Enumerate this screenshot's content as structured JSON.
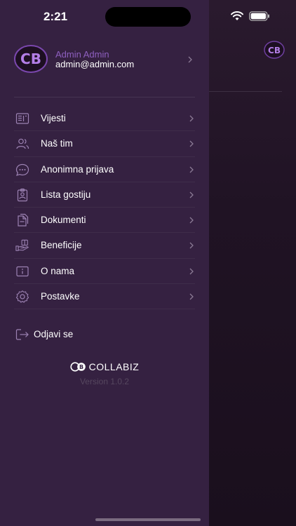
{
  "status_bar": {
    "time": "2:21"
  },
  "profile": {
    "name": "Admin Admin",
    "email": "admin@admin.com",
    "avatar_initials": "CB"
  },
  "menu": [
    {
      "label": "Vijesti",
      "icon": "newspaper-icon"
    },
    {
      "label": "Naš tim",
      "icon": "users-icon"
    },
    {
      "label": "Anonimna prijava",
      "icon": "chat-bubble-icon"
    },
    {
      "label": "Lista gostiju",
      "icon": "id-badge-icon"
    },
    {
      "label": "Dokumenti",
      "icon": "documents-icon"
    },
    {
      "label": "Beneficije",
      "icon": "hand-gift-icon"
    },
    {
      "label": "O nama",
      "icon": "info-icon"
    },
    {
      "label": "Postavke",
      "icon": "settings-icon"
    }
  ],
  "logout": {
    "label": "Odjavi se"
  },
  "brand": {
    "name": "COLLABIZ",
    "version": "Version 1.0.2"
  },
  "colors": {
    "drawer_bg": "#352141",
    "accent": "#8e5fbf",
    "background": "#1c1120"
  }
}
